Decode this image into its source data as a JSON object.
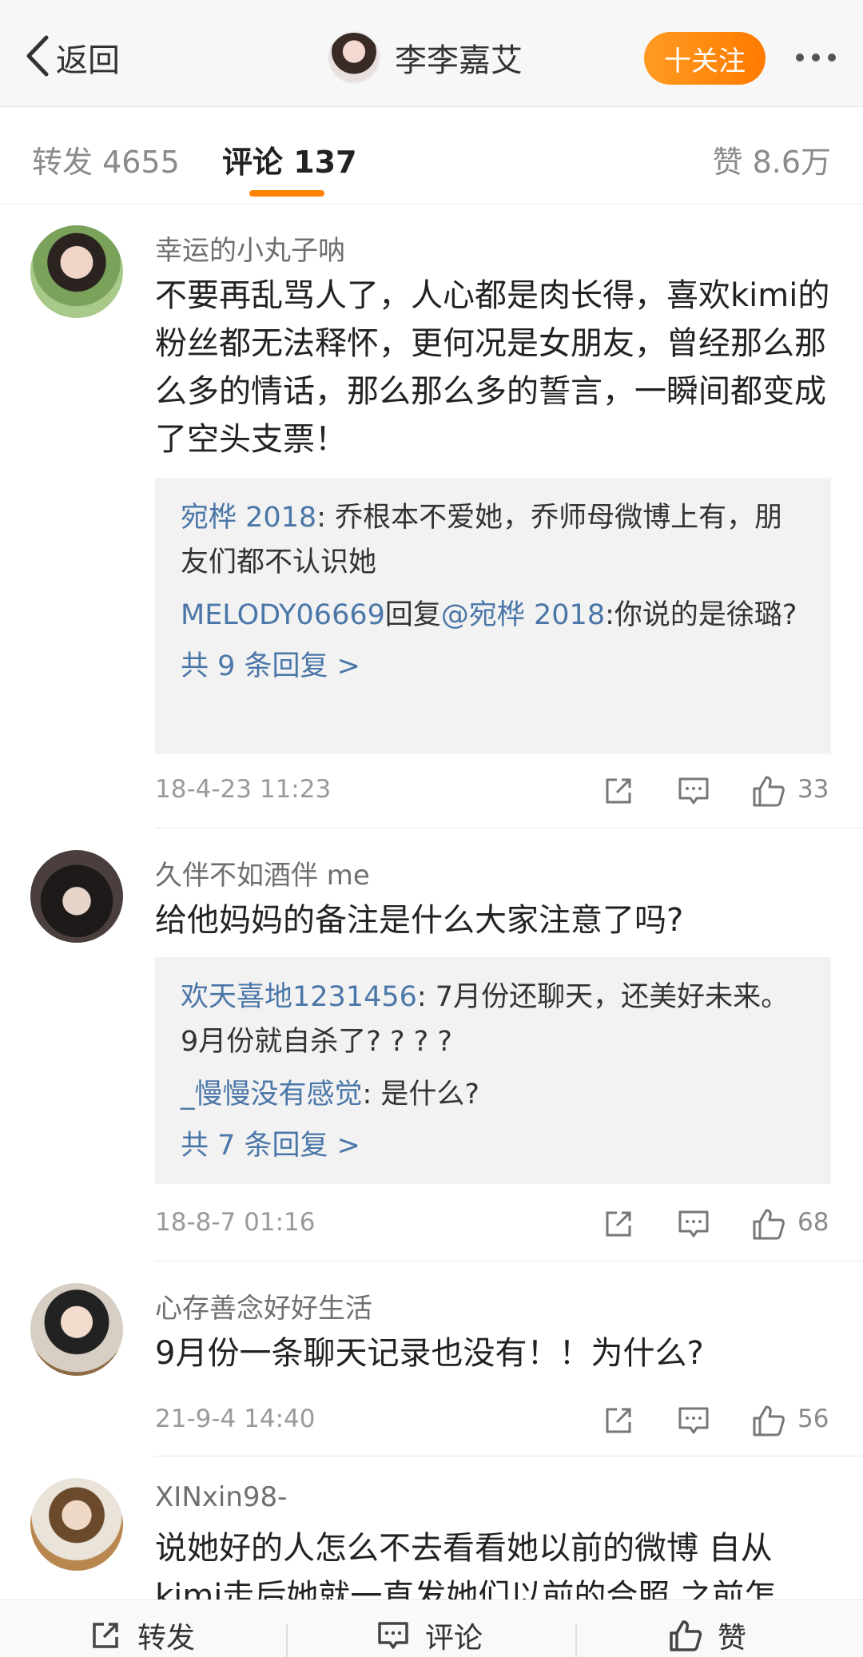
{
  "header": {
    "back_label": "返回",
    "title": "李李嘉艾",
    "follow_label": "十关注"
  },
  "tabs": {
    "forward": "转发 4655",
    "comments": "评论 137",
    "likes": "赞 8.6万"
  },
  "comments": [
    {
      "username": "幸运的小丸子呐",
      "text": "不要再乱骂人了，人心都是肉长得，喜欢kimi的粉丝都无法释怀，更何况是女朋友，曾经那么那么多的情话，那么那么多的誓言，一瞬间都变成了空头支票！",
      "replies": [
        {
          "name": "宛桦 2018",
          "text": ": 乔根本不爱她，乔师母微博上有，朋友们都不认识她"
        },
        {
          "name": "MELODY06669",
          "reply_word": "回复",
          "target": "@宛桦 2018",
          "text": ":你说的是徐璐?"
        }
      ],
      "more_replies": "共 9 条回复 >",
      "time": "18-4-23 11:23",
      "likes": "33"
    },
    {
      "username": "久伴不如酒伴 me",
      "text": "给他妈妈的备注是什么大家注意了吗?",
      "replies": [
        {
          "name": "欢天喜地1231456",
          "text": ": 7月份还聊天，还美好未来。 9月份就自杀了? ? ? ?"
        },
        {
          "name": "_慢慢没有感觉",
          "text": ": 是什么?"
        }
      ],
      "more_replies": "共 7 条回复 >",
      "time": "18-8-7 01:16",
      "likes": "68"
    },
    {
      "username": "心存善念好好生活",
      "text": "9月份一条聊天记录也没有！！为什么?",
      "time": "21-9-4 14:40",
      "likes": "56"
    },
    {
      "username": "XINxin98-",
      "text": "说她好的人怎么不去看看她以前的微博 自从kimi走后她就一直发她们以前的合照 之前怎"
    }
  ],
  "bottom_bar": {
    "forward": "转发",
    "comment": "评论",
    "like": "赞"
  },
  "colors": {
    "accent": "#ff8200",
    "link": "#4b77a8"
  }
}
